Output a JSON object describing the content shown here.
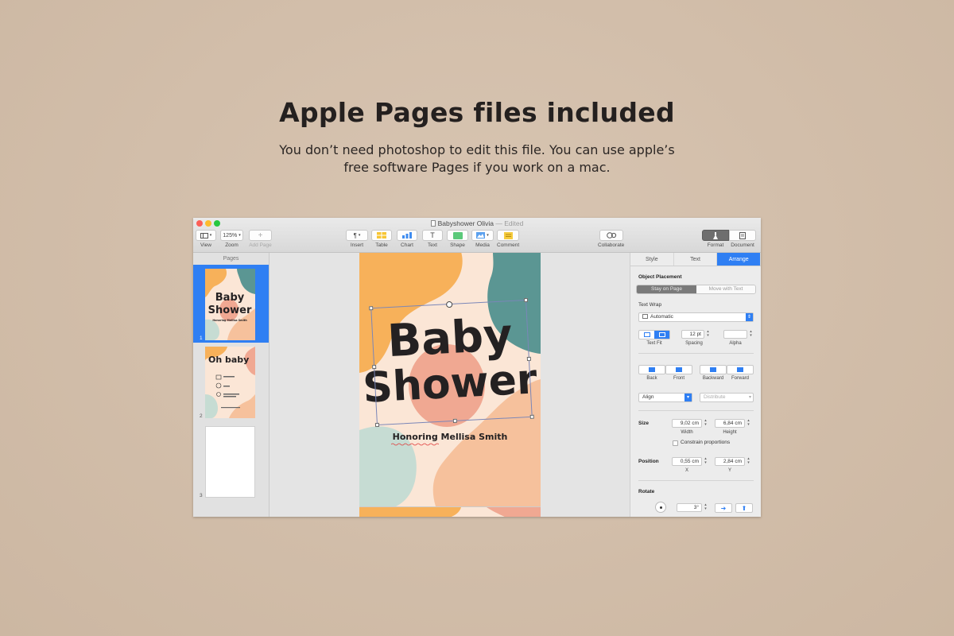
{
  "headline": "Apple Pages files included",
  "subline": {
    "line1": "You don’t need photoshop to edit this file. You can use apple’s",
    "line2": "free software Pages if you work on a mac."
  },
  "window": {
    "title": "Babyshower Olivia",
    "edited": "— Edited"
  },
  "toolbar": {
    "view_label": "View",
    "zoom_value": "125%",
    "zoom_label": "Zoom",
    "add_page_label": "Add Page",
    "insert_label": "Insert",
    "table_label": "Table",
    "chart_label": "Chart",
    "text_label": "Text",
    "shape_label": "Shape",
    "media_label": "Media",
    "comment_label": "Comment",
    "collaborate_label": "Collaborate",
    "format_label": "Format",
    "document_label": "Document"
  },
  "sidebar": {
    "header": "Pages",
    "pages": [
      {
        "number": "1",
        "title1": "Baby",
        "title2": "Shower",
        "subtitle": "Honoring Mellisa Smith"
      },
      {
        "number": "2",
        "title": "Oh baby"
      },
      {
        "number": "3"
      }
    ]
  },
  "canvas": {
    "title1": "Baby",
    "title2": "Shower",
    "honoring": "Honoring Mellisa Smith"
  },
  "inspector": {
    "tabs": [
      "Style",
      "Text",
      "Arrange"
    ],
    "active_tab": "Arrange",
    "object_placement": "Object Placement",
    "stay_on_page": "Stay on Page",
    "move_with_text": "Move with Text",
    "text_wrap": "Text Wrap",
    "wrap_value": "Automatic",
    "text_fit": "Text Fit",
    "spacing_value": "12 pt",
    "spacing_label": "Spacing",
    "alpha_label": "Alpha",
    "back": "Back",
    "front": "Front",
    "backward": "Backward",
    "forward": "Forward",
    "align": "Align",
    "distribute": "Distribute",
    "size_label": "Size",
    "width_value": "9,02 cm",
    "width_label": "Width",
    "height_value": "6,84 cm",
    "height_label": "Height",
    "constrain": "Constrain proportions",
    "position_label": "Position",
    "x_value": "0,55 cm",
    "x_label": "X",
    "y_value": "2,84 cm",
    "y_label": "Y",
    "rotate_label": "Rotate",
    "angle_value": "3°"
  },
  "colors": {
    "accent_blue": "#2f7ff3",
    "orange": "#f7b15a",
    "teal": "#5b9693",
    "peach": "#f6c19c",
    "salmon": "#f0a892",
    "mint": "#c6dcd3"
  }
}
